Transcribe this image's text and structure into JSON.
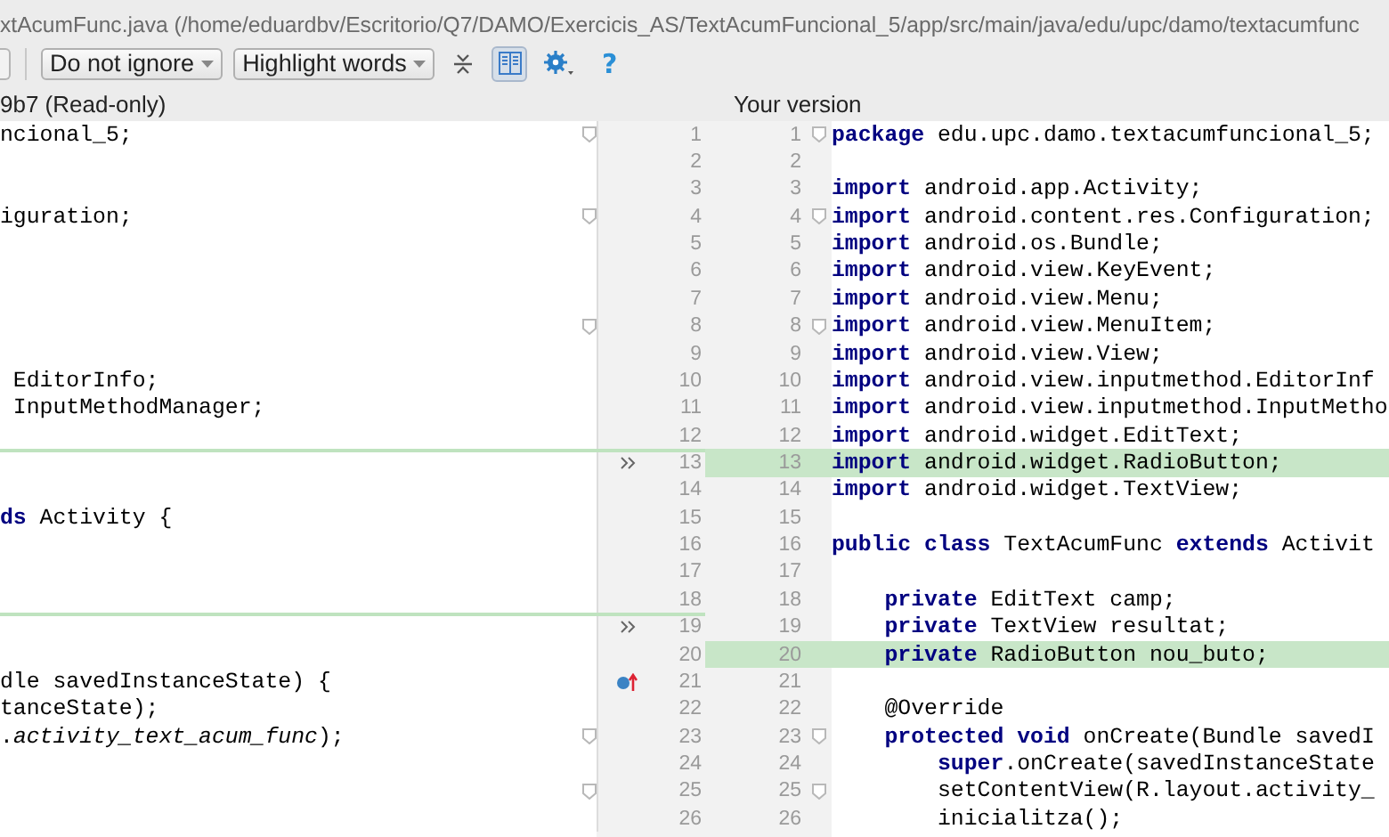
{
  "window": {
    "title": "xtAcumFunc.java (/home/eduardbv/Escritorio/Q7/DAMO/Exercicis_AS/TextAcumFuncional_5/app/src/main/java/edu/upc/damo/textacumfunc"
  },
  "toolbar": {
    "dropdowns": [
      {
        "label": "Do not ignore"
      },
      {
        "label": "Highlight words"
      }
    ],
    "tools": [
      {
        "kind": "collapse",
        "selected": false
      },
      {
        "kind": "side-by-side",
        "selected": true
      },
      {
        "kind": "settings",
        "selected": false
      },
      {
        "kind": "help",
        "label": "?",
        "selected": false
      }
    ]
  },
  "panes": {
    "left_title": "9b7 (Read-only)",
    "right_title": "Your version"
  },
  "rows": [
    {
      "left_code": "ncional_5;",
      "left_number": "1",
      "right_number": "1",
      "right_code": "**package** edu.upc.damo.textacumfuncional_5;",
      "inserted": false,
      "left_marker": false,
      "override_marker": false,
      "fold": true
    },
    {
      "left_code": "",
      "left_number": "2",
      "right_number": "2",
      "right_code": "",
      "inserted": false,
      "left_marker": false,
      "override_marker": false,
      "fold": false
    },
    {
      "left_code": "",
      "left_number": "3",
      "right_number": "3",
      "right_code": "**import** android.app.Activity;",
      "inserted": false,
      "left_marker": false,
      "override_marker": false,
      "fold": false
    },
    {
      "left_code": "iguration;",
      "left_number": "4",
      "right_number": "4",
      "right_code": "**import** android.content.res.Configuration;",
      "inserted": false,
      "left_marker": false,
      "override_marker": false,
      "fold": true
    },
    {
      "left_code": "",
      "left_number": "5",
      "right_number": "5",
      "right_code": "**import** android.os.Bundle;",
      "inserted": false,
      "left_marker": false,
      "override_marker": false,
      "fold": false
    },
    {
      "left_code": "",
      "left_number": "6",
      "right_number": "6",
      "right_code": "**import** android.view.KeyEvent;",
      "inserted": false,
      "left_marker": false,
      "override_marker": false,
      "fold": false
    },
    {
      "left_code": "",
      "left_number": "7",
      "right_number": "7",
      "right_code": "**import** android.view.Menu;",
      "inserted": false,
      "left_marker": false,
      "override_marker": false,
      "fold": false
    },
    {
      "left_code": "",
      "left_number": "8",
      "right_number": "8",
      "right_code": "**import** android.view.MenuItem;",
      "inserted": false,
      "left_marker": false,
      "override_marker": false,
      "fold": true
    },
    {
      "left_code": "",
      "left_number": "9",
      "right_number": "9",
      "right_code": "**import** android.view.View;",
      "inserted": false,
      "left_marker": false,
      "override_marker": false,
      "fold": false
    },
    {
      "left_code": " EditorInfo;",
      "left_number": "10",
      "right_number": "10",
      "right_code": "**import** android.view.inputmethod.EditorInf",
      "inserted": false,
      "left_marker": false,
      "override_marker": false,
      "fold": false
    },
    {
      "left_code": " InputMethodManager;",
      "left_number": "11",
      "right_number": "11",
      "right_code": "**import** android.view.inputmethod.InputMetho",
      "inserted": false,
      "left_marker": false,
      "override_marker": false,
      "fold": false
    },
    {
      "left_code": "",
      "left_number": "12",
      "right_number": "12",
      "right_code": "**import** android.widget.EditText;",
      "inserted": false,
      "left_marker": false,
      "override_marker": false,
      "fold": false
    },
    {
      "left_code": "",
      "left_number": "13",
      "right_number": "13",
      "right_code": "**import** android.widget.RadioButton;",
      "inserted": true,
      "left_marker": true,
      "override_marker": false,
      "fold": false
    },
    {
      "left_code": "",
      "left_number": "14",
      "right_number": "14",
      "right_code": "**import** android.widget.TextView;",
      "inserted": false,
      "left_marker": false,
      "override_marker": false,
      "fold": false
    },
    {
      "left_code": "**ds** Activity {",
      "left_number": "15",
      "right_number": "15",
      "right_code": "",
      "inserted": false,
      "left_marker": false,
      "override_marker": false,
      "fold": false
    },
    {
      "left_code": "",
      "left_number": "16",
      "right_number": "16",
      "right_code": "**public class** TextAcumFunc **extends** Activit",
      "inserted": false,
      "left_marker": false,
      "override_marker": false,
      "fold": false
    },
    {
      "left_code": "",
      "left_number": "17",
      "right_number": "17",
      "right_code": "",
      "inserted": false,
      "left_marker": false,
      "override_marker": false,
      "fold": false
    },
    {
      "left_code": "",
      "left_number": "18",
      "right_number": "18",
      "right_code": "    **private** EditText camp;",
      "inserted": false,
      "left_marker": false,
      "override_marker": false,
      "fold": false
    },
    {
      "left_code": "",
      "left_number": "19",
      "right_number": "19",
      "right_code": "    **private** TextView resultat;",
      "inserted": false,
      "left_marker": true,
      "override_marker": false,
      "fold": false
    },
    {
      "left_code": "",
      "left_number": "20",
      "right_number": "20",
      "right_code": "    **private** RadioButton nou_buto;",
      "inserted": true,
      "left_marker": false,
      "override_marker": false,
      "fold": false
    },
    {
      "left_code": "dle savedInstanceState) {",
      "left_number": "21",
      "right_number": "21",
      "right_code": "",
      "inserted": false,
      "left_marker": false,
      "override_marker": true,
      "fold": false
    },
    {
      "left_code": "tanceState);",
      "left_number": "22",
      "right_number": "22",
      "right_code": "    @Override",
      "inserted": false,
      "left_marker": false,
      "override_marker": false,
      "fold": false
    },
    {
      "left_code": ".*activity_text_acum_func*);",
      "left_number": "23",
      "right_number": "23",
      "right_code": "    **protected void** onCreate(Bundle savedI",
      "inserted": false,
      "left_marker": false,
      "override_marker": false,
      "fold": true
    },
    {
      "left_code": "",
      "left_number": "24",
      "right_number": "24",
      "right_code": "        **super**.onCreate(savedInstanceState",
      "inserted": false,
      "left_marker": false,
      "override_marker": false,
      "fold": false
    },
    {
      "left_code": "",
      "left_number": "25",
      "right_number": "25",
      "right_code": "        setContentView(R.layout.activity_",
      "inserted": false,
      "left_marker": false,
      "override_marker": false,
      "fold": true
    },
    {
      "left_code": "",
      "left_number": "26",
      "right_number": "26",
      "right_code": "        inicialitza();",
      "inserted": false,
      "left_marker": false,
      "override_marker": false,
      "fold": false
    }
  ]
}
